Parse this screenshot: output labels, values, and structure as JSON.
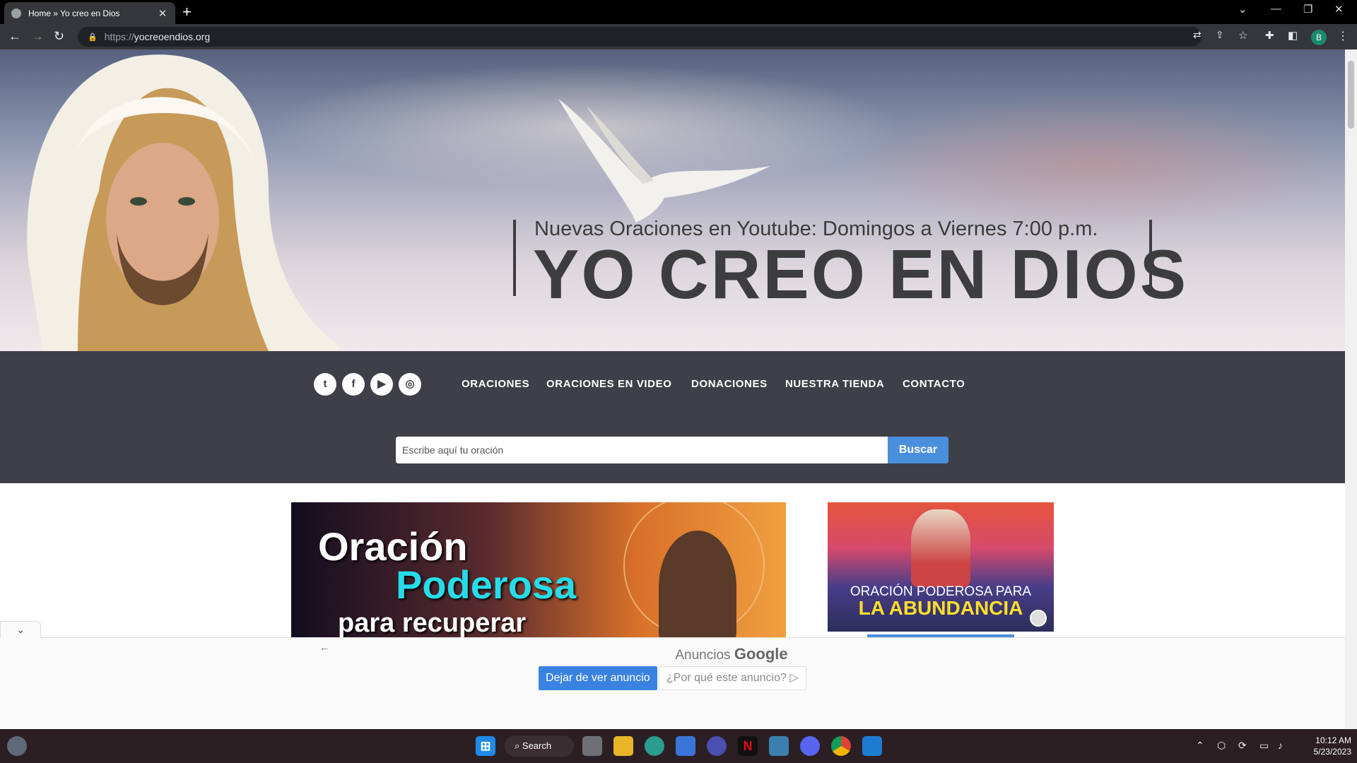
{
  "browser": {
    "tab_title": "Home » Yo creo en Dios",
    "tab_close": "✕",
    "new_tab": "+",
    "url_scheme": "https://",
    "url_host": "yocreoendios.org",
    "profile_initial": "B"
  },
  "hero": {
    "tagline": "Nuevas Oraciones en Youtube: Domingos a Viernes 7:00 p.m.",
    "site_name": "YO CREO EN DIOS"
  },
  "nav": {
    "social": [
      {
        "icon": "twitter-icon",
        "glyph": "t"
      },
      {
        "icon": "facebook-icon",
        "glyph": "f"
      },
      {
        "icon": "youtube-icon",
        "glyph": "▶"
      },
      {
        "icon": "instagram-icon",
        "glyph": "◎"
      }
    ],
    "menu": [
      "ORACIONES",
      "ORACIONES EN VIDEO",
      "DONACIONES",
      "NUESTRA TIENDA",
      "CONTACTO"
    ]
  },
  "search": {
    "placeholder": "Escribe aquí tu oración",
    "button": "Buscar"
  },
  "cards": {
    "card1": {
      "line1": "Oración",
      "line2": "Poderosa",
      "line3": "para recuperar"
    },
    "card2": {
      "line1": "ORACIÓN PODEROSA PARA",
      "line2": "LA ABUNDANCIA"
    }
  },
  "ad": {
    "label_prefix": "Anuncios",
    "label_brand": "Google",
    "stop_button": "Dejar de ver anuncio",
    "why_button": "¿Por qué este anuncio? ▷"
  },
  "taskbar": {
    "search_label": "Search",
    "time": "10:12 AM",
    "date": "5/23/2023"
  },
  "colors": {
    "nav_bg": "#3f3f4a",
    "accent": "#4a8fdc",
    "title_dark": "#3d3d40"
  }
}
